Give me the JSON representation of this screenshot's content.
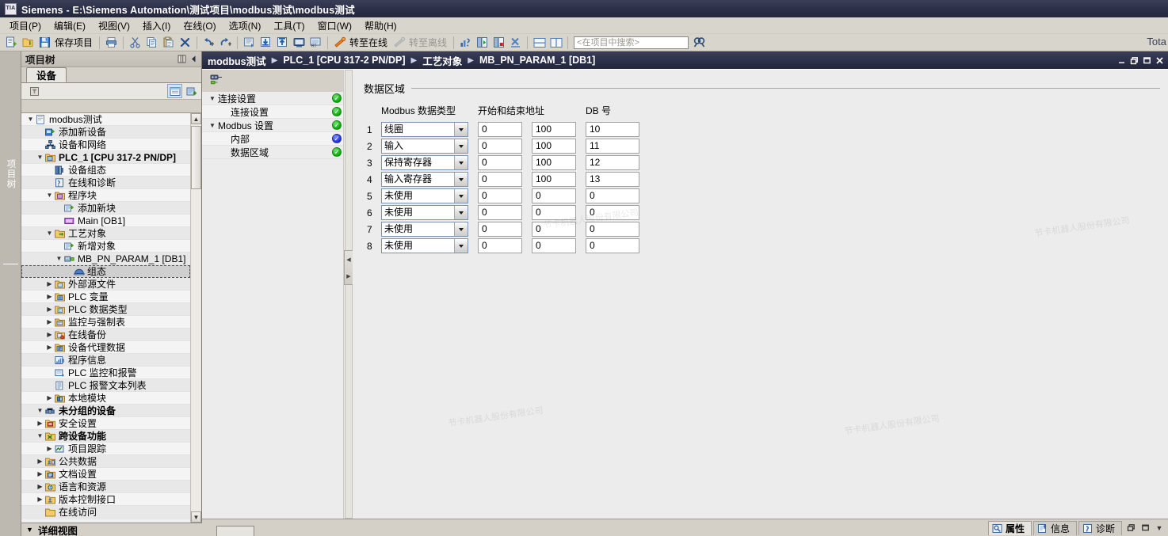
{
  "window": {
    "title": "Siemens  -  E:\\Siemens Automation\\测试项目\\modbus测试\\modbus测试",
    "logo": "TIA",
    "brand": "Tota"
  },
  "menubar": {
    "items": [
      {
        "label": "项目(P)"
      },
      {
        "label": "编辑(E)"
      },
      {
        "label": "视图(V)"
      },
      {
        "label": "插入(I)"
      },
      {
        "label": "在线(O)"
      },
      {
        "label": "选项(N)"
      },
      {
        "label": "工具(T)"
      },
      {
        "label": "窗口(W)"
      },
      {
        "label": "帮助(H)"
      }
    ]
  },
  "toolbar": {
    "new_project_icon": "new-project-icon",
    "open_project_icon": "open-project-icon",
    "save_icon": "save-icon",
    "save_label": "保存项目",
    "print_icon": "print-icon",
    "cut_icon": "cut-icon",
    "copy_icon": "copy-icon",
    "paste_icon": "paste-icon",
    "delete_icon": "delete-icon",
    "undo_icon": "undo-icon",
    "redo_icon": "redo-icon",
    "compile_icon": "compile-icon",
    "download_icon": "download-to-device-icon",
    "upload_icon": "upload-from-device-icon",
    "start_sim_icon": "start-simulation-icon",
    "rt_icon": "start-runtime-icon",
    "go_online_icon": "go-online-icon",
    "go_online_label": "转至在线",
    "go_offline_icon": "go-offline-icon",
    "go_offline_label": "转至离线",
    "diagnostics_icon": "diagnostics-icon",
    "start_cpu_icon": "start-cpu-icon",
    "stop_cpu_icon": "stop-cpu-icon",
    "cross_ref_icon": "cross-reference-icon",
    "split_h_icon": "split-editor-horizontal-icon",
    "split_v_icon": "split-editor-vertical-icon",
    "search_placeholder": "<在项目中搜索>",
    "search_value": "",
    "find_icon": "find-icon"
  },
  "left_edge": {
    "vertical_tab_label": "项目树"
  },
  "project_tree": {
    "header_title": "项目树",
    "pin_icon": "pin-icon",
    "collapse_icon": "collapse-left-icon",
    "tab_label": "设备",
    "toolbar": {
      "filter_icon": "filter-icon",
      "detail_icon": "detail-view-icon",
      "add_icon": "add-device-icon"
    },
    "items": [
      {
        "depth": 0,
        "twist": "down",
        "icon": "project-icon",
        "label": "modbus测试",
        "bold": false
      },
      {
        "depth": 1,
        "twist": "",
        "icon": "add-device-icon",
        "label": "添加新设备",
        "bold": false
      },
      {
        "depth": 1,
        "twist": "",
        "icon": "network-icon",
        "label": "设备和网络",
        "bold": false
      },
      {
        "depth": 1,
        "twist": "down",
        "icon": "plc-icon",
        "label": "PLC_1 [CPU 317-2 PN/DP]",
        "bold": true
      },
      {
        "depth": 2,
        "twist": "",
        "icon": "device-config-icon",
        "label": "设备组态",
        "bold": false
      },
      {
        "depth": 2,
        "twist": "",
        "icon": "online-diag-icon",
        "label": "在线和诊断",
        "bold": false
      },
      {
        "depth": 2,
        "twist": "down",
        "icon": "program-blocks-icon",
        "label": "程序块",
        "bold": false
      },
      {
        "depth": 3,
        "twist": "",
        "icon": "add-block-icon",
        "label": "添加新块",
        "bold": false
      },
      {
        "depth": 3,
        "twist": "",
        "icon": "ob-block-icon",
        "label": "Main [OB1]",
        "bold": false
      },
      {
        "depth": 2,
        "twist": "down",
        "icon": "tech-objects-icon",
        "label": "工艺对象",
        "bold": false
      },
      {
        "depth": 3,
        "twist": "",
        "icon": "add-object-icon",
        "label": "新增对象",
        "bold": false
      },
      {
        "depth": 3,
        "twist": "down",
        "icon": "param-db-icon",
        "label": "MB_PN_PARAM_1 [DB1]",
        "bold": false
      },
      {
        "depth": 4,
        "twist": "",
        "icon": "configuration-icon",
        "label": "组态",
        "bold": false,
        "state": "selected"
      },
      {
        "depth": 2,
        "twist": "right",
        "icon": "external-source-icon",
        "label": "外部源文件",
        "bold": false
      },
      {
        "depth": 2,
        "twist": "right",
        "icon": "plc-tags-icon",
        "label": "PLC 变量",
        "bold": false
      },
      {
        "depth": 2,
        "twist": "right",
        "icon": "plc-datatypes-icon",
        "label": "PLC 数据类型",
        "bold": false
      },
      {
        "depth": 2,
        "twist": "right",
        "icon": "watch-tables-icon",
        "label": "监控与强制表",
        "bold": false
      },
      {
        "depth": 2,
        "twist": "right",
        "icon": "online-backup-icon",
        "label": "在线备份",
        "bold": false
      },
      {
        "depth": 2,
        "twist": "right",
        "icon": "device-proxy-icon",
        "label": "设备代理数据",
        "bold": false
      },
      {
        "depth": 2,
        "twist": "",
        "icon": "program-info-icon",
        "label": "程序信息",
        "bold": false
      },
      {
        "depth": 2,
        "twist": "",
        "icon": "plc-alarms-icon",
        "label": "PLC 监控和报警",
        "bold": false
      },
      {
        "depth": 2,
        "twist": "",
        "icon": "alarm-textlist-icon",
        "label": "PLC 报警文本列表",
        "bold": false
      },
      {
        "depth": 2,
        "twist": "right",
        "icon": "local-modules-icon",
        "label": "本地模块",
        "bold": false
      },
      {
        "depth": 1,
        "twist": "down",
        "icon": "ungrouped-icon",
        "label": "未分组的设备",
        "bold": true
      },
      {
        "depth": 1,
        "twist": "right",
        "icon": "security-icon",
        "label": "安全设置",
        "bold": false
      },
      {
        "depth": 1,
        "twist": "down",
        "icon": "crossdevice-icon",
        "label": "跨设备功能",
        "bold": true
      },
      {
        "depth": 2,
        "twist": "right",
        "icon": "project-trace-icon",
        "label": "项目跟踪",
        "bold": false
      },
      {
        "depth": 1,
        "twist": "right",
        "icon": "common-data-icon",
        "label": "公共数据",
        "bold": false
      },
      {
        "depth": 1,
        "twist": "right",
        "icon": "doc-settings-icon",
        "label": "文档设置",
        "bold": false
      },
      {
        "depth": 1,
        "twist": "right",
        "icon": "languages-icon",
        "label": "语言和资源",
        "bold": false
      },
      {
        "depth": 1,
        "twist": "right",
        "icon": "version-control-icon",
        "label": "版本控制接口",
        "bold": false
      },
      {
        "depth": 1,
        "twist": "",
        "icon": "online-access-icon",
        "label": "在线访问",
        "bold": false
      }
    ],
    "detail_view_label": "详细视图"
  },
  "editor": {
    "breadcrumb": [
      "modbus测试",
      "PLC_1 [CPU 317-2 PN/DP]",
      "工艺对象",
      "MB_PN_PARAM_1 [DB1]"
    ],
    "window_buttons": {
      "minimize": "minimize-icon",
      "restore": "restore-icon",
      "maximize": "maximize-icon",
      "close": "close-icon"
    },
    "nav_tool_icon": "parameter-view-icon",
    "nav": [
      {
        "label": "连接设置",
        "twist": "down",
        "status": "green",
        "indent": 0,
        "selected": false
      },
      {
        "label": "连接设置",
        "twist": "",
        "status": "green",
        "indent": 1,
        "selected": false
      },
      {
        "label": "Modbus 设置",
        "twist": "down",
        "status": "green",
        "indent": 0,
        "selected": false
      },
      {
        "label": "内部",
        "twist": "",
        "status": "blue",
        "indent": 1,
        "selected": false
      },
      {
        "label": "数据区域",
        "twist": "",
        "status": "green",
        "indent": 1,
        "selected": true
      }
    ],
    "content": {
      "section_title": "数据区域",
      "columns": {
        "datatype": "Modbus 数据类型",
        "address": "开始和结束地址",
        "db": "DB 号"
      },
      "rows": [
        {
          "index": "1",
          "datatype": "线圈",
          "start": "0",
          "end": "100",
          "db": "10"
        },
        {
          "index": "2",
          "datatype": "输入",
          "start": "0",
          "end": "100",
          "db": "11"
        },
        {
          "index": "3",
          "datatype": "保持寄存器",
          "start": "0",
          "end": "100",
          "db": "12"
        },
        {
          "index": "4",
          "datatype": "输入寄存器",
          "start": "0",
          "end": "100",
          "db": "13"
        },
        {
          "index": "5",
          "datatype": "未使用",
          "start": "0",
          "end": "0",
          "db": "0"
        },
        {
          "index": "6",
          "datatype": "未使用",
          "start": "0",
          "end": "0",
          "db": "0"
        },
        {
          "index": "7",
          "datatype": "未使用",
          "start": "0",
          "end": "0",
          "db": "0"
        },
        {
          "index": "8",
          "datatype": "未使用",
          "start": "0",
          "end": "0",
          "db": "0"
        }
      ]
    },
    "status_tabs": [
      {
        "label": "属性",
        "icon": "properties-icon",
        "active": true
      },
      {
        "label": "信息",
        "icon": "info-icon",
        "active": false
      },
      {
        "label": "诊断",
        "icon": "diagnostics-icon",
        "active": false
      }
    ],
    "status_buttons": {
      "restore": "restore-small-icon",
      "minimize": "minimize-small-icon",
      "dropdown": "chevron-down-icon"
    }
  },
  "colors": {
    "titlebar": "#2c3049",
    "chrome": "#d4d0c8",
    "panel": "#ececec",
    "status_ok": "#0cab0c",
    "status_info": "#2030d8",
    "selection": "#b8d3ee"
  },
  "watermark": "节卡机器人股份有限公司"
}
